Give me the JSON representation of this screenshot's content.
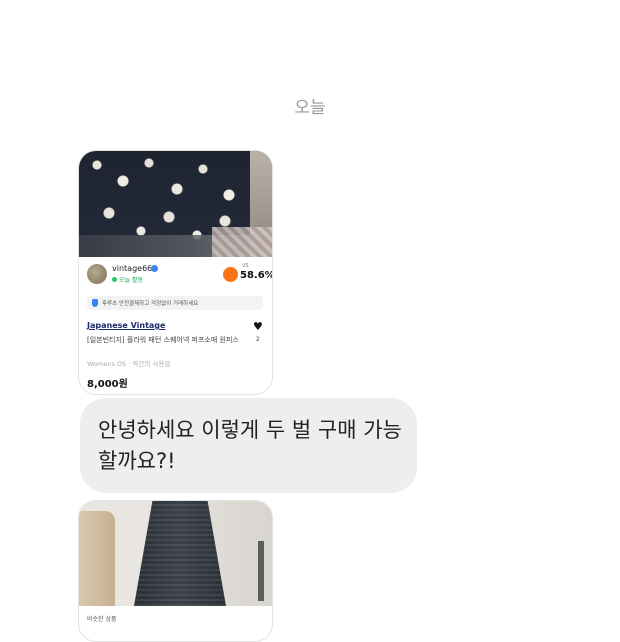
{
  "top_cut": {
    "text": "",
    "link": ""
  },
  "date_separator": "오늘",
  "product_card": {
    "seller_name": "vintage66",
    "seller_status": "오늘 활동",
    "grade_label": "VS",
    "grade_value": "58.6%",
    "notice": "후루츠 안전결제하고 걱정없이 거래하세요",
    "brand": "Japanese Vintage",
    "title": "[일본빈티지] 플라워 패턴 스퀘어넥 퍼프소매 원피스",
    "meta": "Womens OS · 약간의 사용감",
    "price": "8,000원",
    "like_count": "2",
    "heart_icon": "♥"
  },
  "message": {
    "text": "안녕하세요 이렇게 두 벌 구매 가능할까요?!"
  },
  "second_card": {
    "label": "비슷한 상품",
    "carousel_count": 4,
    "active_index": 0
  },
  "colors": {
    "bubble": "#eeeeee",
    "brand": "#1b2a6b",
    "status": "#22a65a"
  }
}
